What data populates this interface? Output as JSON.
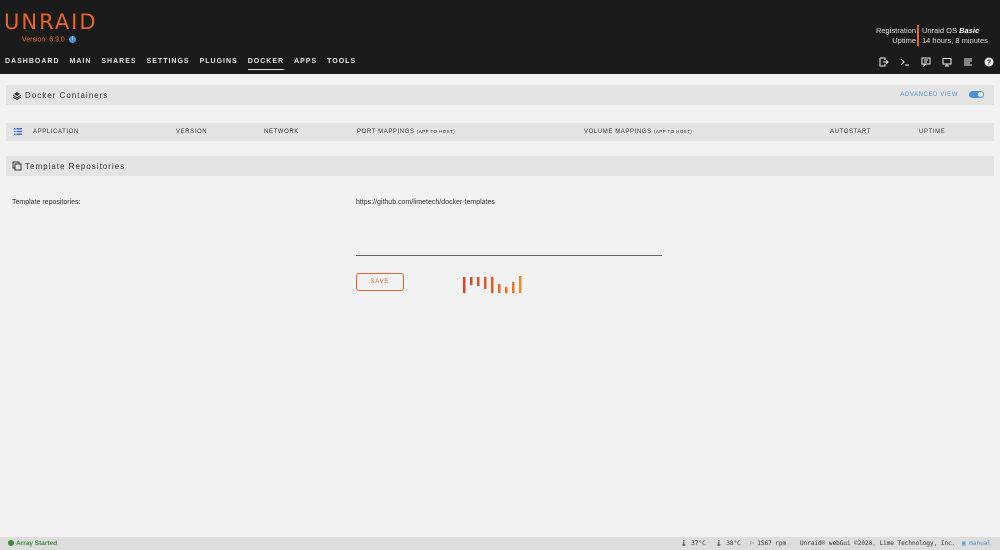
{
  "app": {
    "name": "UNRAID",
    "version": "Version: 6.9.0"
  },
  "header": {
    "registration_label": "Registration",
    "uptime_label": "Uptime",
    "os_prefix": "Unraid OS",
    "os_edition": "Basic",
    "uptime_value": "14 hours, 8 minutes"
  },
  "nav": {
    "items": [
      "DASHBOARD",
      "MAIN",
      "SHARES",
      "SETTINGS",
      "PLUGINS",
      "DOCKER",
      "APPS",
      "TOOLS"
    ],
    "active": "DOCKER",
    "icons": [
      "logout-icon",
      "terminal-icon",
      "feedback-icon",
      "info-icon",
      "log-icon",
      "help-icon"
    ]
  },
  "docker": {
    "title": "Docker Containers",
    "advanced_view_label": "ADVANCED VIEW",
    "advanced_view_on": true,
    "columns": {
      "application": "APPLICATION",
      "version": "VERSION",
      "network": "NETWORK",
      "port_mappings": "PORT MAPPINGS",
      "port_mappings_note": "(APP TO HOST)",
      "volume_mappings": "VOLUME MAPPINGS",
      "volume_mappings_note": "(APP TO HOST)",
      "autostart": "AUTOSTART",
      "uptime": "UPTIME"
    }
  },
  "templates": {
    "title": "Template Repositories",
    "field_label": "Template repositories:",
    "field_value": "https://github.com/limetech/docker-templates",
    "save_label": "SAVE"
  },
  "footer": {
    "array_status": "Array Started",
    "temp1": "37°C",
    "temp2": "38°C",
    "fan": "1567 rpm",
    "copyright": "Unraid® webGui ©2020, Lime Technology, Inc.",
    "manual": "manual"
  },
  "colors": {
    "accent": "#e8642b",
    "link": "#4a8fd9",
    "header_bg": "#1c1b1b",
    "status_green": "#3a8b36"
  }
}
